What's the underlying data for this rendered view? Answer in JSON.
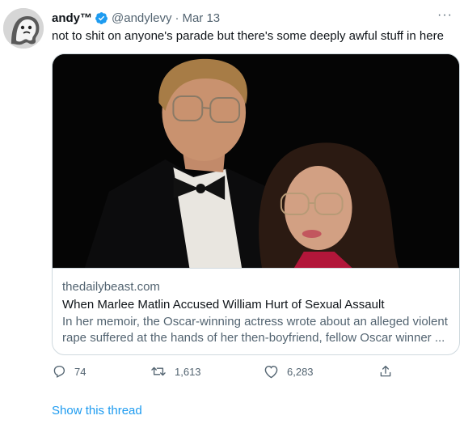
{
  "tweet": {
    "author_name": "andy™",
    "handle": "@andylevy",
    "separator": "·",
    "date": "Mar 13",
    "more_label": "···",
    "text": "not to shit on anyone's parade but there's some deeply awful stuff in here"
  },
  "card": {
    "domain": "thedailybeast.com",
    "title": "When Marlee Matlin Accused William Hurt of Sexual Assault",
    "description": "In her memoir, the Oscar-winning actress wrote about an alleged violent rape suffered at the hands of her then-boyfriend, fellow Oscar winner ..."
  },
  "actions": {
    "replies": "74",
    "retweets": "1,613",
    "likes": "6,283"
  },
  "show_thread_label": "Show this thread",
  "colors": {
    "text": "#0f1419",
    "secondary": "#536471",
    "accent": "#1d9bf0",
    "border": "#cfd9de"
  },
  "icons": [
    "verified-badge-icon",
    "more-icon",
    "reply-icon",
    "retweet-icon",
    "like-icon",
    "share-icon"
  ]
}
